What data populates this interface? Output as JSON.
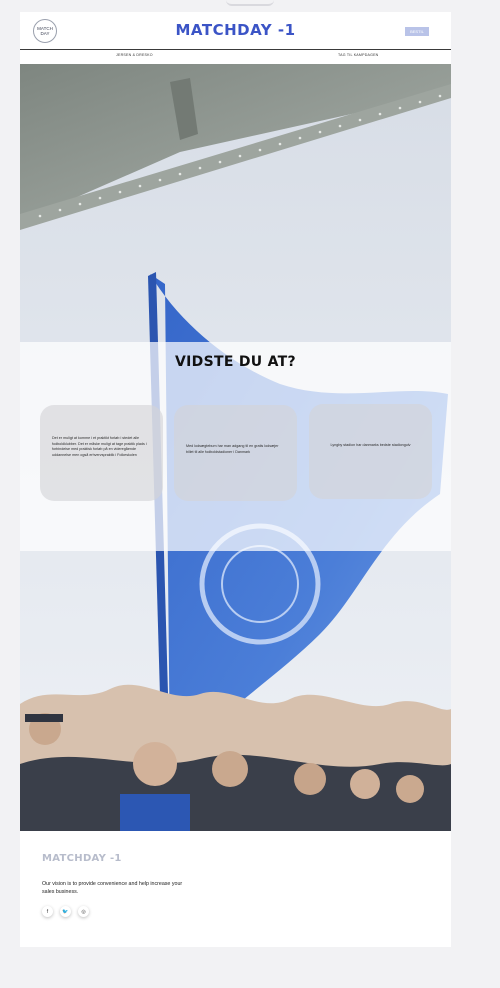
{
  "header": {
    "logo_line1": "MATCH",
    "logo_line2": "DAY",
    "brand": "MATCHDAY -1",
    "button_label": "BESTIL"
  },
  "nav": {
    "items": [
      {
        "label": "JERSEN & DRESKO"
      },
      {
        "label": "TAG TIL KAMPDAGEN"
      }
    ]
  },
  "hero": {
    "title": "VIDSTE DU AT?",
    "cards": [
      {
        "text": "Det er muligt at komme i et praktikt forløb i stedet alle fodboldklubber. Det er måske muligt at tage praktik plads i forbindelse med praktisk forløb på en videregående uddannelse men også erhvervspraktik i Folkeskolen"
      },
      {
        "text": "Med lodsægtebum har man adgang til en gratis lodsæjer billet til alle fodboldstadioner i Danmark"
      },
      {
        "text": "Lyngby stadion har danmarks bedste stadiongulv"
      }
    ]
  },
  "footer": {
    "brand": "MATCHDAY -1",
    "vision": "Our vision is to provide convenience and help increase your sales business.",
    "social": [
      {
        "icon": "facebook-icon",
        "glyph": "f"
      },
      {
        "icon": "twitter-icon",
        "glyph": "🐦"
      },
      {
        "icon": "instagram-icon",
        "glyph": "◎"
      }
    ]
  },
  "colors": {
    "brand": "#3b54c6",
    "button": "#b9c3e8",
    "flag": "#2f62c8",
    "page_bg": "#f2f2f4"
  }
}
